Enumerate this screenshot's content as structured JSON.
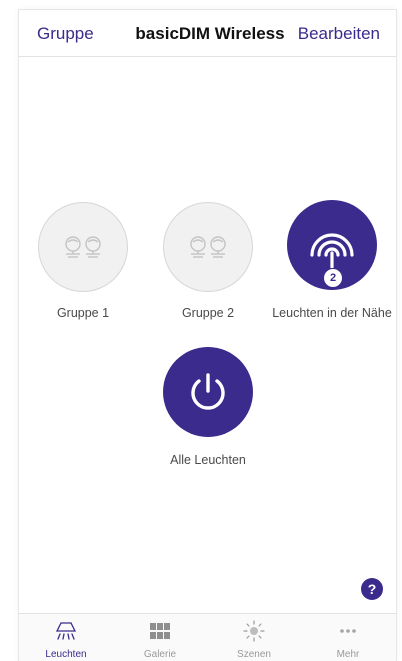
{
  "navbar": {
    "left": "Gruppe",
    "title": "basicDIM Wireless",
    "right": "Bearbeiten"
  },
  "tiles": [
    {
      "label": "Gruppe 1",
      "icon": "lamps-icon",
      "style": "grey"
    },
    {
      "label": "Gruppe 2",
      "icon": "lamps-icon",
      "style": "grey"
    },
    {
      "label": "Leuchten in der Nähe",
      "icon": "wireless-signal-icon",
      "style": "purple",
      "badge": "2"
    },
    {
      "label": "Alle Leuchten",
      "icon": "power-icon",
      "style": "purple"
    }
  ],
  "help": {
    "label": "?"
  },
  "tabbar": {
    "items": [
      {
        "label": "Leuchten",
        "icon": "ceiling-light-icon",
        "active": true
      },
      {
        "label": "Galerie",
        "icon": "grid-icon",
        "active": false
      },
      {
        "label": "Szenen",
        "icon": "sun-icon",
        "active": false
      },
      {
        "label": "Mehr",
        "icon": "more-dots-icon",
        "active": false
      }
    ]
  },
  "colors": {
    "accent": "#3a2b8c",
    "grey_circle": "#f1f1f1",
    "label_text": "#4a4a4a",
    "inactive_tab": "#9a9a9a"
  }
}
